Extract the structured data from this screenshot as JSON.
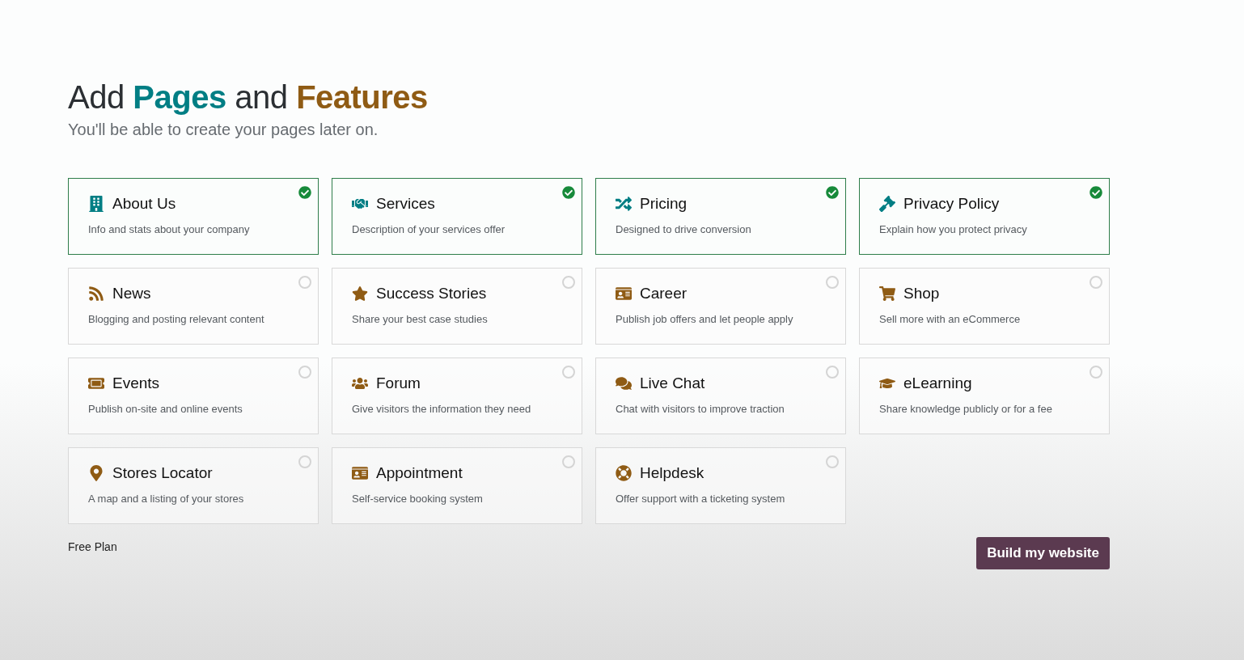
{
  "title": [
    {
      "text": "Add ",
      "kind": "plain"
    },
    {
      "text": "Pages",
      "kind": "primary"
    },
    {
      "text": " and ",
      "kind": "plain"
    },
    {
      "text": "Features",
      "kind": "secondary"
    }
  ],
  "subtitle": "You'll be able to create your pages later on.",
  "features": [
    {
      "name": "About Us",
      "description": "Info and stats about your company",
      "selected": true
    },
    {
      "name": "Services",
      "description": "Description of your services offer",
      "selected": true
    },
    {
      "name": "Pricing",
      "description": "Designed to drive conversion",
      "selected": true
    },
    {
      "name": "Privacy Policy",
      "description": "Explain how you protect privacy",
      "selected": true
    },
    {
      "name": "News",
      "description": "Blogging and posting relevant content",
      "selected": false
    },
    {
      "name": "Success Stories",
      "description": "Share your best case studies",
      "selected": false
    },
    {
      "name": "Career",
      "description": "Publish job offers and let people apply",
      "selected": false
    },
    {
      "name": "Shop",
      "description": "Sell more with an eCommerce",
      "selected": false
    },
    {
      "name": "Events",
      "description": "Publish on-site and online events",
      "selected": false
    },
    {
      "name": "Forum",
      "description": "Give visitors the information they need",
      "selected": false
    },
    {
      "name": "Live Chat",
      "description": "Chat with visitors to improve traction",
      "selected": false
    },
    {
      "name": "eLearning",
      "description": "Share knowledge publicly or for a fee",
      "selected": false
    },
    {
      "name": "Stores Locator",
      "description": "A map and a listing of your stores",
      "selected": false
    },
    {
      "name": "Appointment",
      "description": "Self-service booking system",
      "selected": false
    },
    {
      "name": "Helpdesk",
      "description": "Offer support with a ticketing system",
      "selected": false
    }
  ],
  "plan": "Free Plan",
  "build_button": "Build my website"
}
